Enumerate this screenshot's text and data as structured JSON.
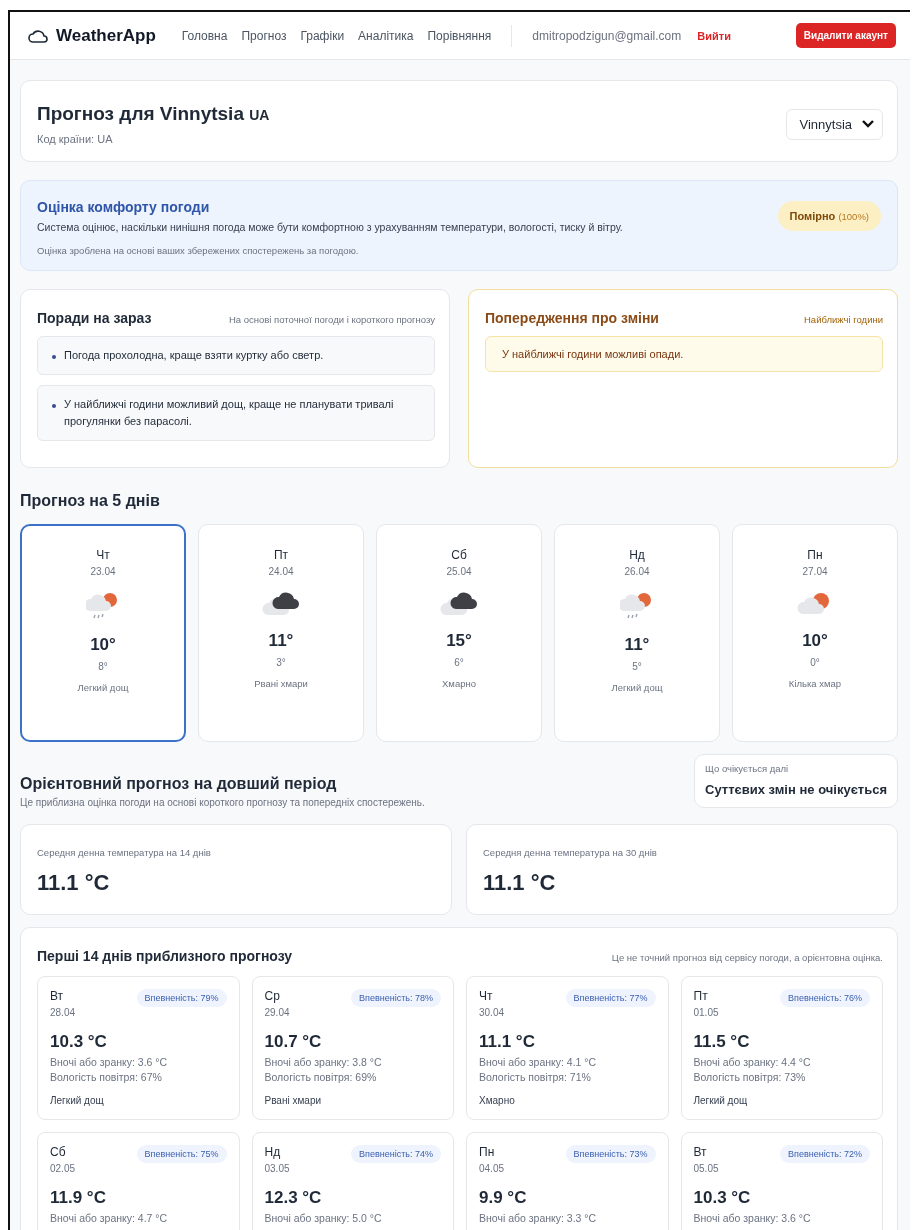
{
  "header": {
    "logo": "WeatherApp",
    "nav": [
      {
        "label": "Головна"
      },
      {
        "label": "Прогноз"
      },
      {
        "label": "Графіки"
      },
      {
        "label": "Аналітика"
      },
      {
        "label": "Порівняння"
      }
    ],
    "email": "dmitropodzigun@gmail.com",
    "logout": "Вийти",
    "delete": "Видалити акаунт"
  },
  "title_card": {
    "title": "Прогноз для Vinnytsia",
    "country_badge": "UA",
    "subtitle": "Код країни: UA",
    "city_select": {
      "value": "Vinnytsia"
    }
  },
  "comfort": {
    "title": "Оцінка комфорту погоди",
    "description": "Система оцінює, наскільки нинішня погода може бути комфортною з урахуванням температури, вологості, тиску й вітру.",
    "note": "Оцінка зроблена на основі ваших збережених спостережень за погодою.",
    "badge": {
      "label": "Помірно",
      "value": "(100%)"
    }
  },
  "tips": {
    "title": "Поради на зараз",
    "subtitle": "На основі поточної погоди і короткого прогнозу",
    "items": [
      "Погода прохолодна, краще взяти куртку або светр.",
      "У найближчі години можливий дощ, краще не планувати тривалі прогулянки без парасолі."
    ]
  },
  "warnings": {
    "title": "Попередження про зміни",
    "subtitle": "Найближчі години",
    "items": [
      "У найближчі години можливі опади."
    ]
  },
  "forecast": {
    "title": "Прогноз на 5 днів",
    "days": [
      {
        "day": "Чт",
        "date": "23.04",
        "kind": "rain-sun",
        "high": "10°",
        "low": "8°",
        "condition": "Легкий дощ",
        "selected": true
      },
      {
        "day": "Пт",
        "date": "24.04",
        "kind": "clouds",
        "high": "11°",
        "low": "3°",
        "condition": "Рвані хмари",
        "selected": false
      },
      {
        "day": "Сб",
        "date": "25.04",
        "kind": "clouds",
        "high": "15°",
        "low": "6°",
        "condition": "Хмарно",
        "selected": false
      },
      {
        "day": "Нд",
        "date": "26.04",
        "kind": "rain-sun",
        "high": "11°",
        "low": "5°",
        "condition": "Легкий дощ",
        "selected": false
      },
      {
        "day": "Пн",
        "date": "27.04",
        "kind": "sun-cloud",
        "high": "10°",
        "low": "0°",
        "condition": "Кілька хмар",
        "selected": false
      }
    ]
  },
  "long_range": {
    "title": "Орієнтовний прогноз на довший період",
    "subtitle": "Це приблизна оцінка погоди на основі короткого прогнозу та попередніх спостережень.",
    "outlook": {
      "label": "Що очікується далі",
      "value": "Суттєвих змін не очікується"
    }
  },
  "averages": [
    {
      "label": "Середня денна температура на 14 днів",
      "value": "11.1 °C"
    },
    {
      "label": "Середня денна температура на 30 днів",
      "value": "11.1 °C"
    }
  ],
  "approx": {
    "title": "Перші 14 днів приблизного прогнозу",
    "note": "Це не точний прогноз від сервісу погоди, а орієнтовна оцінка.",
    "days": [
      {
        "day": "Вт",
        "date": "28.04",
        "confidence": "Впевненість: 79%",
        "temp": "10.3 °C",
        "night": "Вночі або зранку: 3.6 °C",
        "humidity": "Вологість повітря: 67%",
        "condition": "Легкий дощ"
      },
      {
        "day": "Ср",
        "date": "29.04",
        "confidence": "Впевненість: 78%",
        "temp": "10.7 °C",
        "night": "Вночі або зранку: 3.8 °C",
        "humidity": "Вологість повітря: 69%",
        "condition": "Рвані хмари"
      },
      {
        "day": "Чт",
        "date": "30.04",
        "confidence": "Впевненість: 77%",
        "temp": "11.1 °C",
        "night": "Вночі або зранку: 4.1 °C",
        "humidity": "Вологість повітря: 71%",
        "condition": "Хмарно"
      },
      {
        "day": "Пт",
        "date": "01.05",
        "confidence": "Впевненість: 76%",
        "temp": "11.5 °C",
        "night": "Вночі або зранку: 4.4 °C",
        "humidity": "Вологість повітря: 73%",
        "condition": "Легкий дощ"
      },
      {
        "day": "Сб",
        "date": "02.05",
        "confidence": "Впевненість: 75%",
        "temp": "11.9 °C",
        "night": "Вночі або зранку: 4.7 °C"
      },
      {
        "day": "Нд",
        "date": "03.05",
        "confidence": "Впевненість: 74%",
        "temp": "12.3 °C",
        "night": "Вночі або зранку: 5.0 °C"
      },
      {
        "day": "Пн",
        "date": "04.05",
        "confidence": "Впевненість: 73%",
        "temp": "9.9 °C",
        "night": "Вночі або зранку: 3.3 °C"
      },
      {
        "day": "Вт",
        "date": "05.05",
        "confidence": "Впевненість: 72%",
        "temp": "10.3 °C",
        "night": "Вночі або зранку: 3.6 °C"
      }
    ]
  }
}
